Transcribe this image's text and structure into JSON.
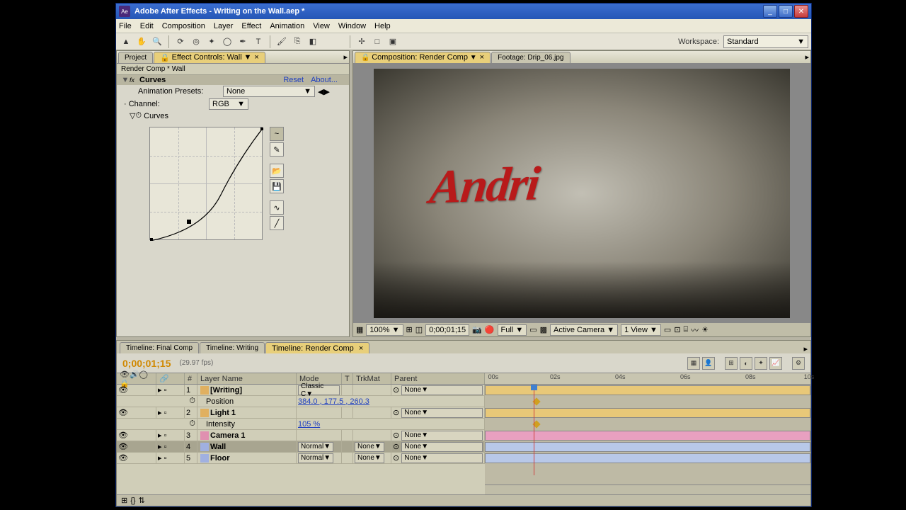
{
  "titlebar": {
    "app": "Adobe After Effects",
    "document": "Writing on the Wall.aep *"
  },
  "menus": [
    "File",
    "Edit",
    "Composition",
    "Layer",
    "Effect",
    "Animation",
    "View",
    "Window",
    "Help"
  ],
  "workspace": {
    "label": "Workspace:",
    "value": "Standard"
  },
  "left_panel": {
    "tab_project": "Project",
    "tab_effect": "Effect Controls: Wall",
    "breadcrumb": "Render Comp * Wall",
    "effect_name": "Curves",
    "reset": "Reset",
    "about": "About...",
    "anim_presets_label": "Animation Presets:",
    "anim_presets_value": "None",
    "channel_label": "Channel:",
    "channel_value": "RGB",
    "curves_label": "Curves"
  },
  "comp_panel": {
    "tab_comp": "Composition: Render Comp",
    "tab_footage": "Footage: Drip_06.jpg",
    "preview_text": "Andri",
    "footer": {
      "zoom": "100%",
      "time": "0;00;01;15",
      "res": "Full",
      "camera": "Active Camera",
      "view": "1 View"
    }
  },
  "timeline": {
    "tabs": [
      "Timeline: Final Comp",
      "Timeline: Writing",
      "Timeline: Render Comp"
    ],
    "timecode": "0;00;01;15",
    "fps": "(29.97 fps)",
    "cols": {
      "num": "#",
      "name": "Layer Name",
      "mode": "Mode",
      "t": "T",
      "trkmat": "TrkMat",
      "parent": "Parent"
    },
    "ruler": [
      "00s",
      "02s",
      "04s",
      "06s",
      "08s",
      "10s"
    ],
    "layers": [
      {
        "n": "1",
        "color": "#e0b060",
        "name": "[Writing]",
        "mode": "Classic C",
        "parent": "None",
        "prop": "Position",
        "val": "384.0 , 177.5 , 260.3"
      },
      {
        "n": "2",
        "color": "#e0b060",
        "name": "Light 1",
        "parent": "None",
        "prop": "Intensity",
        "val": "105 %"
      },
      {
        "n": "3",
        "color": "#e090b0",
        "name": "Camera 1",
        "parent": "None"
      },
      {
        "n": "4",
        "color": "#a0b0e0",
        "name": "Wall",
        "mode": "Normal",
        "trkmat": "None",
        "parent": "None"
      },
      {
        "n": "5",
        "color": "#a0b0e0",
        "name": "Floor",
        "mode": "Normal",
        "trkmat": "None",
        "parent": "None"
      }
    ]
  }
}
